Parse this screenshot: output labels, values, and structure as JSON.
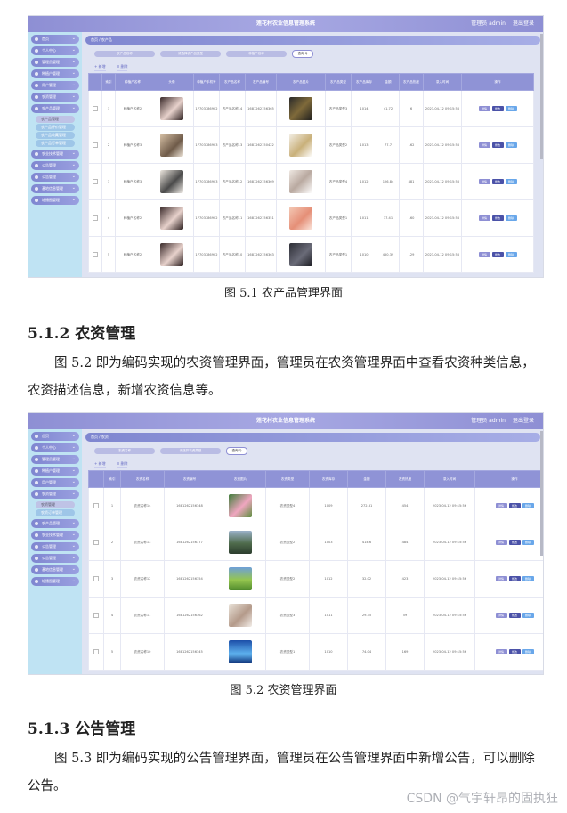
{
  "screenshot1": {
    "app_title": "莲花村农业信息管理系统",
    "top_right": [
      "管理员 admin",
      "退出登录"
    ],
    "sidebar": [
      "首页",
      "个人中心",
      "管理员管理",
      "种植户管理",
      "用户管理",
      "农资管理",
      "农产品管理",
      "农产品管理",
      "农产品评价管理",
      "农产品收藏管理",
      "农产品订单管理",
      "农业技术管理",
      "公告管理",
      "公告管理",
      "基地信息管理",
      "轮播图管理"
    ],
    "breadcrumb": "首页 / 农产品",
    "search": [
      "农产品名称",
      "请选择农产品类型",
      "种植户名称"
    ],
    "search_btn": "查询 Q",
    "actions": [
      "+ 新增",
      "☰ 删除"
    ],
    "headers": [
      "",
      "索引",
      "种植户名称",
      "头像",
      "种植户手机号",
      "农产品名称",
      "农产品编号",
      "农产品图片",
      "农产品类型",
      "农产品库存",
      "金额",
      "农产品热度",
      "录入时间",
      "操作"
    ],
    "rows": [
      [
        "",
        "1",
        "种植户名称2",
        "p1",
        "17703786902",
        "农产品名称14",
        "1681262156365",
        "p4",
        "农产品类型3",
        "1014",
        "41.72",
        "6",
        "2023-04-12 09:15:56"
      ],
      [
        "",
        "2",
        "种植户名称3",
        "p2",
        "17703786903",
        "农产品名称13",
        "1681262150422",
        "p5",
        "农产品类型2",
        "1013",
        "77.7",
        "162",
        "2023-04-12 09:15:56"
      ],
      [
        "",
        "3",
        "种植户名称3",
        "p3",
        "17703786903",
        "农产品名称12",
        "1681262156369",
        "p6",
        "农产品类型4",
        "1012",
        "126.84",
        "481",
        "2023-04-12 09:15:56"
      ],
      [
        "",
        "4",
        "种植户名称2",
        "p1",
        "17703786902",
        "农产品名称11",
        "1681262156351",
        "p7",
        "农产品类型1",
        "1011",
        "37.41",
        "160",
        "2023-04-12 09:15:56"
      ],
      [
        "",
        "5",
        "种植户名称2",
        "p1",
        "17703786902",
        "农产品名称10",
        "1681262156363",
        "p8",
        "农产品类型1",
        "1010",
        "450.39",
        "129",
        "2023-04-12 09:15:56"
      ]
    ],
    "ops": [
      "详情",
      "修改",
      "删除"
    ]
  },
  "caption1": "图 5.1  农产品管理界面",
  "heading2": "5.1.2  农资管理",
  "para2": "图 5.2 即为编码实现的农资管理界面，管理员在农资管理界面中查看农资种类信息，农资描述信息，新增农资信息等。",
  "screenshot2": {
    "app_title": "莲花村农业信息管理系统",
    "top_right": [
      "管理员 admin",
      "退出登录"
    ],
    "sidebar": [
      "首页",
      "个人中心",
      "管理员管理",
      "种植户管理",
      "用户管理",
      "农资管理",
      "农资管理",
      "农资订单管理",
      "农产品管理",
      "农业技术管理",
      "公告管理",
      "公告管理",
      "基地信息管理",
      "轮播图管理"
    ],
    "breadcrumb": "首页 / 农资",
    "search": [
      "农资名称",
      "请选择农资类型"
    ],
    "search_btn": "查询 Q",
    "actions": [
      "+ 新增",
      "☰ 删除"
    ],
    "headers": [
      "",
      "索引",
      "农资名称",
      "农资编号",
      "农资图片",
      "农资类型",
      "农资库存",
      "金额",
      "农资热度",
      "录入时间",
      "操作"
    ],
    "rows": [
      [
        "",
        "1",
        "农资名称14",
        "1681262156348",
        "g1",
        "农资类型4",
        "1009",
        "272.31",
        "454",
        "2023-04-12 09:15:56"
      ],
      [
        "",
        "2",
        "农资名称13",
        "1681262156377",
        "g2",
        "农资类型2",
        "1003",
        "414.6",
        "484",
        "2023-04-12 09:15:56"
      ],
      [
        "",
        "3",
        "农资名称12",
        "1681262156354",
        "g3",
        "农资类型2",
        "1012",
        "32.02",
        "423",
        "2023-04-12 09:15:56"
      ],
      [
        "",
        "4",
        "农资名称11",
        "1681262156362",
        "g4",
        "农资类型3",
        "1011",
        "29.35",
        "59",
        "2023-04-12 09:15:56"
      ],
      [
        "",
        "5",
        "农资名称10",
        "1681262156345",
        "g5",
        "农资类型1",
        "1010",
        "74.04",
        "169",
        "2023-04-12 09:15:56"
      ]
    ],
    "ops": [
      "详情",
      "修改",
      "删除"
    ]
  },
  "caption2": "图 5.2  农资管理界面",
  "heading3": "5.1.3  公告管理",
  "para3": "图 5.3 即为编码实现的公告管理界面，管理员在公告管理界面中新增公告，可以删除公告。",
  "watermark": "CSDN @气宇轩昂的固执狂"
}
